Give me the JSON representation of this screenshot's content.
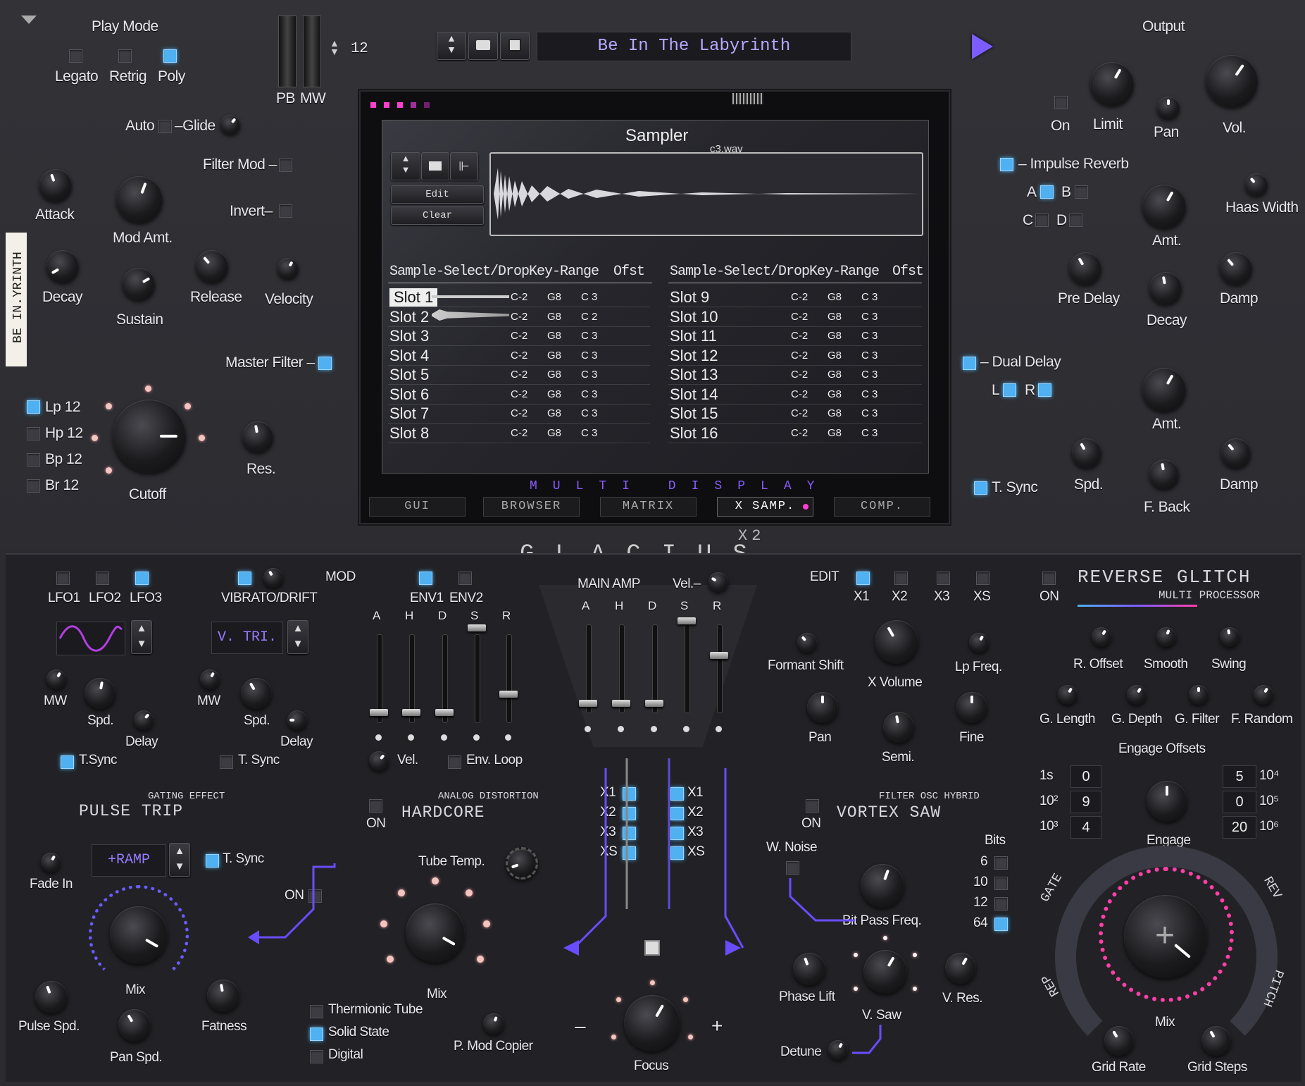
{
  "playmode": {
    "title": "Play Mode",
    "legato": "Legato",
    "retrig": "Retrig",
    "poly": "Poly"
  },
  "pb": "PB",
  "mw": "MW",
  "voices": "12",
  "preset_name": "Be In The Labyrinth",
  "glide": {
    "auto": "Auto",
    "glide": "–Glide"
  },
  "filtermod": "Filter Mod –",
  "invert": "Invert–",
  "env_top": {
    "attack": "Attack",
    "modamt": "Mod Amt.",
    "decay": "Decay",
    "sustain": "Sustain",
    "release": "Release",
    "velocity": "Velocity"
  },
  "masterfilter": "Master Filter –",
  "filters": [
    "Lp 12",
    "Hp 12",
    "Bp 12",
    "Br 12"
  ],
  "cutoff": "Cutoff",
  "res": "Res.",
  "side_tag": "BE IN.YRINTH",
  "sampler": {
    "title": "Sampler",
    "file": "c3.wav",
    "edit": "Edit",
    "clear": "Clear",
    "headers": [
      "Sample-Select/Drop",
      "Key-Range",
      "Ofst"
    ],
    "slots_left": [
      [
        "Slot 1",
        "C-2",
        "G8",
        "C 3"
      ],
      [
        "Slot 2",
        "C-2",
        "G8",
        "C 2"
      ],
      [
        "Slot 3",
        "C-2",
        "G8",
        "C 3"
      ],
      [
        "Slot 4",
        "C-2",
        "G8",
        "C 3"
      ],
      [
        "Slot 5",
        "C-2",
        "G8",
        "C 3"
      ],
      [
        "Slot 6",
        "C-2",
        "G8",
        "C 3"
      ],
      [
        "Slot 7",
        "C-2",
        "G8",
        "C 3"
      ],
      [
        "Slot 8",
        "C-2",
        "G8",
        "C 3"
      ]
    ],
    "slots_right": [
      [
        "Slot 9",
        "C-2",
        "G8",
        "C 3"
      ],
      [
        "Slot 10",
        "C-2",
        "G8",
        "C 3"
      ],
      [
        "Slot 11",
        "C-2",
        "G8",
        "C 3"
      ],
      [
        "Slot 12",
        "C-2",
        "G8",
        "C 3"
      ],
      [
        "Slot 13",
        "C-2",
        "G8",
        "C 3"
      ],
      [
        "Slot 14",
        "C-2",
        "G8",
        "C 3"
      ],
      [
        "Slot 15",
        "C-2",
        "G8",
        "C 3"
      ],
      [
        "Slot 16",
        "C-2",
        "G8",
        "C 3"
      ]
    ]
  },
  "multi_display": "MULTI DISPLAY",
  "tabs": [
    "GUI",
    "BROWSER",
    "MATRIX",
    "X SAMP.",
    "COMP."
  ],
  "output": {
    "title": "Output",
    "on": "On",
    "limit": "Limit",
    "pan": "Pan",
    "vol": "Vol."
  },
  "reverb": {
    "title": "– Impulse Reverb",
    "a": "A",
    "b": "B",
    "c": "C",
    "d": "D",
    "amt": "Amt.",
    "haas": "Haas Width",
    "predelay": "Pre Delay",
    "decay": "Decay",
    "damp": "Damp"
  },
  "delay": {
    "title": "– Dual Delay",
    "l": "L",
    "r": "R",
    "amt": "Amt.",
    "tsync": "T. Sync",
    "spd": "Spd.",
    "fback": "F. Back",
    "damp": "Damp"
  },
  "logo": "GLACIUS",
  "logo_sub": "X2",
  "lfo": {
    "lfo1": "LFO1",
    "lfo2": "LFO2",
    "lfo3": "LFO3",
    "mw": "MW",
    "spd": "Spd.",
    "delay": "Delay",
    "tsync": "T.Sync"
  },
  "vib": {
    "title": "VIBRATO/DRIFT",
    "mod": "MOD",
    "shape": "V. TRI.",
    "mw": "MW",
    "spd": "Spd.",
    "delay": "Delay",
    "tsync": "T. Sync"
  },
  "env": {
    "env1": "ENV1",
    "env2": "ENV2",
    "adsr": [
      "A",
      "H",
      "D",
      "S",
      "R"
    ],
    "vel": "Vel.",
    "envloop": "Env. Loop"
  },
  "mainamp": {
    "title": "MAIN AMP",
    "vel": "Vel.–",
    "adsr": [
      "A",
      "H",
      "D",
      "S",
      "R"
    ]
  },
  "edit": {
    "title": "EDIT",
    "x1": "X1",
    "x2": "X2",
    "x3": "X3",
    "xs": "XS",
    "formant": "Formant Shift",
    "xvol": "X Volume",
    "lpfreq": "Lp Freq.",
    "pan": "Pan",
    "semi": "Semi.",
    "fine": "Fine"
  },
  "glitch": {
    "title": "REVERSE GLITCH",
    "sub": "MULTI PROCESSOR",
    "on": "ON",
    "roffset": "R. Offset",
    "smooth": "Smooth",
    "swing": "Swing",
    "glength": "G. Length",
    "gdepth": "G. Depth",
    "gfilter": "G. Filter",
    "frandom": "F. Random",
    "engage_offsets": "Engage Offsets",
    "engage": "Engage",
    "mix": "Mix",
    "gridrate": "Grid Rate",
    "gridsteps": "Grid Steps",
    "gate": "GATE",
    "rev": "REV",
    "rep": "REP",
    "pitch": "PITCH",
    "offsets_left": [
      [
        "1s",
        "0"
      ],
      [
        "10²",
        "9"
      ],
      [
        "10³",
        "4"
      ]
    ],
    "offsets_right": [
      [
        "5",
        "10⁴"
      ],
      [
        "0",
        "10⁵"
      ],
      [
        "20",
        "10⁶"
      ]
    ]
  },
  "pulse": {
    "sub": "GATING EFFECT",
    "title": "PULSE TRIP",
    "ramp": "+RAMP",
    "tsync": "T. Sync",
    "fadein": "Fade In",
    "mix": "Mix",
    "on": "ON",
    "pulsespd": "Pulse Spd.",
    "panspd": "Pan Spd.",
    "fatness": "Fatness"
  },
  "hardcore": {
    "sub": "ANALOG DISTORTION",
    "title": "HARDCORE",
    "on": "ON",
    "tube": "Tube Temp.",
    "mix": "Mix",
    "opts": [
      "Thermionic Tube",
      "Solid State",
      "Digital"
    ],
    "pmod": "P. Mod Copier"
  },
  "route": {
    "left": [
      "X1",
      "X2",
      "X3",
      "XS"
    ],
    "right": [
      "X1",
      "X2",
      "X3",
      "XS"
    ],
    "focus": "Focus",
    "minus": "–",
    "plus": "+"
  },
  "vortex": {
    "sub": "FILTER OSC HYBRID",
    "title": "VORTEX SAW",
    "on": "ON",
    "wnoise": "W. Noise",
    "bits": "Bits",
    "bitvals": [
      "6",
      "10",
      "12",
      "64"
    ],
    "bitpass": "Bit Pass Freq.",
    "phaselift": "Phase Lift",
    "vsaw": "V. Saw",
    "vres": "V. Res.",
    "detune": "Detune"
  },
  "colors": {
    "accent": "#4fb0f2",
    "purple": "#7b5cff",
    "pink": "#ff3fa8"
  }
}
